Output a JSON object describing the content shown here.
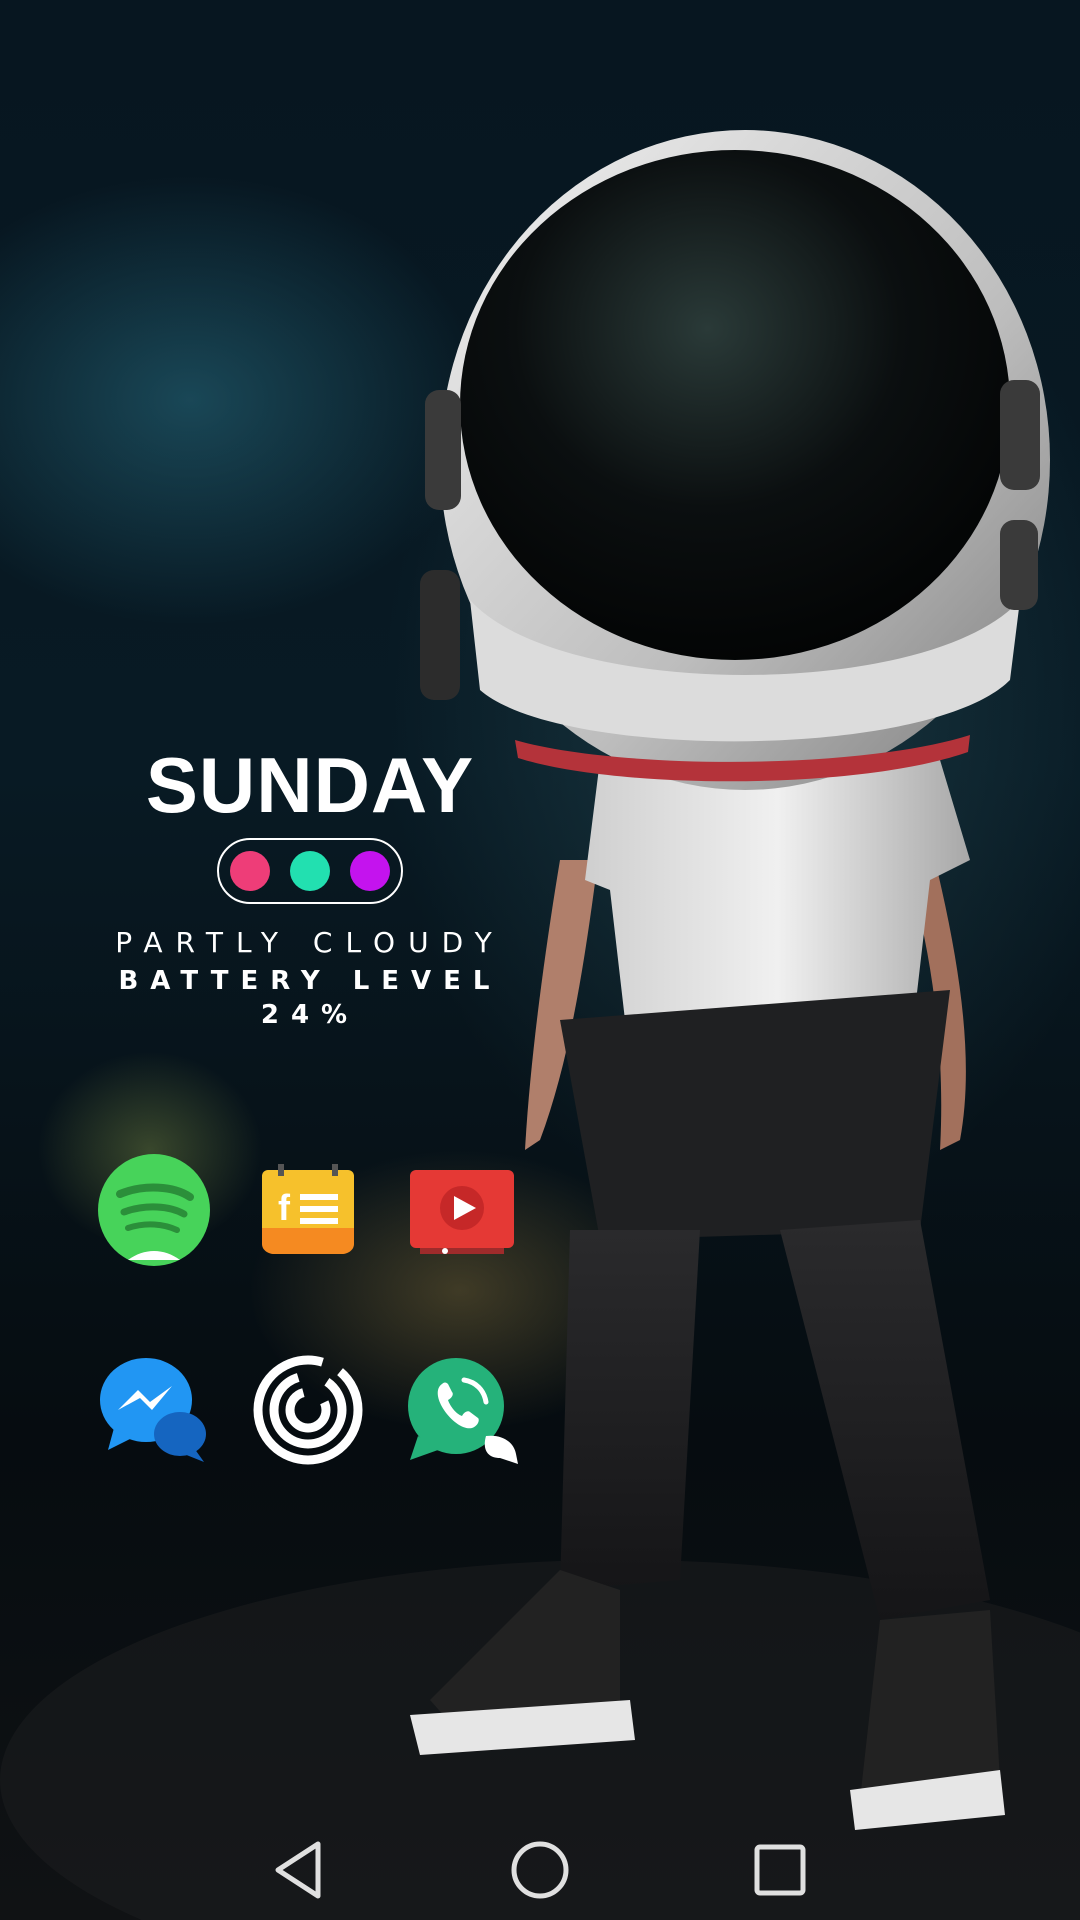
{
  "widget": {
    "day": "SUNDAY",
    "dot_colors": [
      "#ee3d78",
      "#22e0b0",
      "#c413ee"
    ],
    "weather": "PARTLY CLOUDY",
    "battery": "BATTERY LEVEL 24%"
  },
  "apps": [
    {
      "name": "spotify",
      "icon": "spotify-icon",
      "color": "#47d35a"
    },
    {
      "name": "facebook-notes",
      "icon": "facebook-notes-icon",
      "color": "#f6c12c"
    },
    {
      "name": "youtube",
      "icon": "youtube-icon",
      "color": "#e53935"
    },
    {
      "name": "messenger",
      "icon": "messenger-icon",
      "color": "#1e88e5"
    },
    {
      "name": "maze-circle",
      "icon": "maze-circle-icon",
      "color": "#ffffff"
    },
    {
      "name": "whatsapp",
      "icon": "whatsapp-icon",
      "color": "#25b27a"
    }
  ],
  "navbar": {
    "buttons": [
      "back-icon",
      "home-icon",
      "recents-icon"
    ]
  }
}
